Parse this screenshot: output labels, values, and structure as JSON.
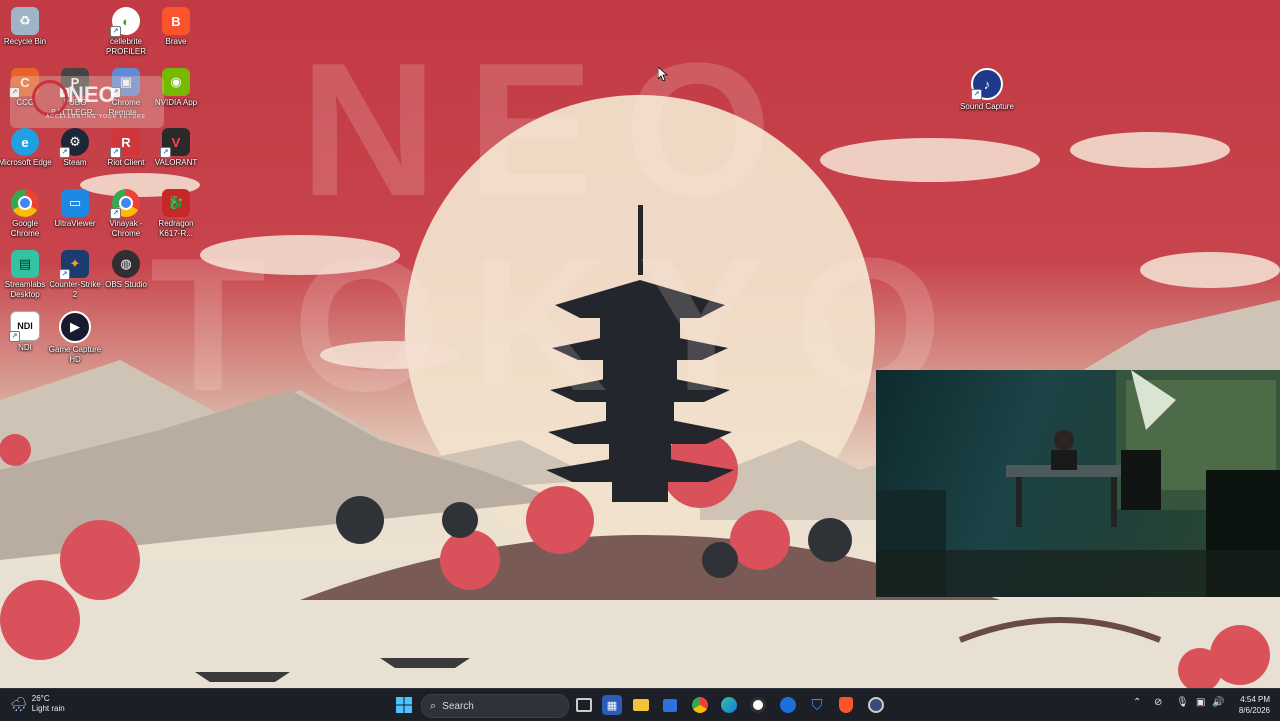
{
  "desktop": {
    "wallpaper_text": [
      "NEO",
      "TOKYO"
    ],
    "icons": [
      {
        "label": "Recycle Bin",
        "icon": "recycle-bin-icon",
        "color": "#9fb4c8"
      },
      {
        "label": "cellebrite PROFILER",
        "icon": "cellebrite-icon",
        "color": "#ffffff"
      },
      {
        "label": "Brave",
        "icon": "brave-icon",
        "color": "#fb542b"
      },
      {
        "label": "CCC",
        "icon": "ccc-icon",
        "color": "#e8622a"
      },
      {
        "label": "PUBG BATTLEGR...",
        "icon": "pubg-icon",
        "color": "#444444"
      },
      {
        "label": "Chrome Remote...",
        "icon": "chrome-remote-icon",
        "color": "#5f8bd6"
      },
      {
        "label": "NVIDIA App",
        "icon": "nvidia-icon",
        "color": "#76b900"
      },
      {
        "label": "Microsoft Edge",
        "icon": "edge-icon",
        "color": "#1fa0e0"
      },
      {
        "label": "Steam",
        "icon": "steam-icon",
        "color": "#1b2838"
      },
      {
        "label": "Riot Client",
        "icon": "riot-icon",
        "color": "#d13639"
      },
      {
        "label": "VALORANT",
        "icon": "valorant-icon",
        "color": "#fa4454"
      },
      {
        "label": "Google Chrome",
        "icon": "chrome-icon",
        "color": "#4285f4"
      },
      {
        "label": "UltraViewer",
        "icon": "ultraviewer-icon",
        "color": "#1e88e5"
      },
      {
        "label": "Vinayak - Chrome",
        "icon": "chrome-profile-icon",
        "color": "#4285f4"
      },
      {
        "label": "Redragon K617-R...",
        "icon": "redragon-icon",
        "color": "#c62828"
      },
      {
        "label": "Streamlabs Desktop",
        "icon": "streamlabs-icon",
        "color": "#31c3a2"
      },
      {
        "label": "Counter-Strike 2",
        "icon": "cs2-icon",
        "color": "#f0a22e"
      },
      {
        "label": "OBS Studio",
        "icon": "obs-icon",
        "color": "#302e31"
      },
      {
        "label": "NDI",
        "icon": "ndi-icon",
        "color": "#111111"
      },
      {
        "label": "Game Capture HD",
        "icon": "game-capture-icon",
        "color": "#1a1a2e"
      },
      {
        "label": "Sound Capture",
        "icon": "sound-capture-icon",
        "color": "#1e3a8a"
      }
    ],
    "overlay_logo": {
      "text": "NEO",
      "subtext": "ACCELERATING YOUR FUTURE"
    }
  },
  "taskbar": {
    "weather": {
      "temp": "26°C",
      "condition": "Light rain"
    },
    "search_label": "Search",
    "apps": [
      {
        "icon": "start-icon"
      },
      {
        "icon": "task-view-icon"
      },
      {
        "icon": "widgets-news-icon"
      },
      {
        "icon": "file-explorer-icon"
      },
      {
        "icon": "microsoft-store-icon"
      },
      {
        "icon": "chrome-icon"
      },
      {
        "icon": "edge-icon"
      },
      {
        "icon": "obs-icon"
      },
      {
        "icon": "mail-icon"
      },
      {
        "icon": "defender-icon"
      },
      {
        "icon": "brave-icon"
      },
      {
        "icon": "sound-capture-icon"
      }
    ],
    "clock": {
      "time": "4:54 PM",
      "date": "8/6/2026"
    }
  }
}
